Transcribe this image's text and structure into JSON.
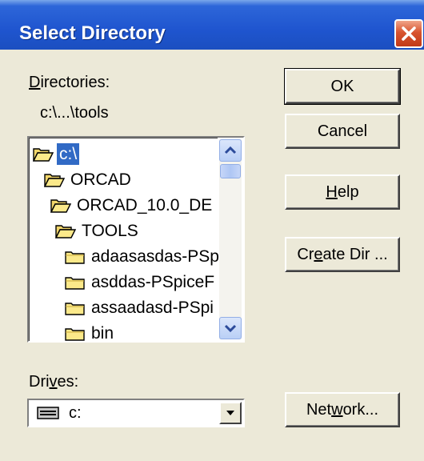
{
  "window": {
    "title": "Select Directory"
  },
  "directories": {
    "label_prefix": "",
    "label_underlined": "D",
    "label_rest": "irectories:",
    "current_path": "c:\\...\\tools",
    "items": [
      {
        "name": "c:\\",
        "selected": true,
        "icon": "open-folder-icon"
      },
      {
        "name": "ORCAD",
        "selected": false,
        "icon": "open-folder-icon"
      },
      {
        "name": "ORCAD_10.0_DE",
        "selected": false,
        "icon": "open-folder-icon"
      },
      {
        "name": "TOOLS",
        "selected": false,
        "icon": "open-folder-icon"
      },
      {
        "name": "adaasasdas-PSp",
        "selected": false,
        "icon": "folder-icon"
      },
      {
        "name": "asddas-PSpiceF",
        "selected": false,
        "icon": "folder-icon"
      },
      {
        "name": "assaadasd-PSpi",
        "selected": false,
        "icon": "folder-icon"
      },
      {
        "name": "bin",
        "selected": false,
        "icon": "folder-icon"
      }
    ]
  },
  "drives": {
    "label_prefix": "Dri",
    "label_underlined": "v",
    "label_rest": "es:",
    "selected": "c:"
  },
  "buttons": {
    "ok": "OK",
    "cancel": "Cancel",
    "help_underlined": "H",
    "help_rest": "elp",
    "create_prefix": "Cr",
    "create_underlined": "e",
    "create_rest": "ate Dir ...",
    "network_prefix": "Net",
    "network_underlined": "w",
    "network_rest": "ork..."
  },
  "colors": {
    "title_bar": "#1f55cf",
    "selection": "#316ac5",
    "dialog_bg": "#ece9d8"
  }
}
